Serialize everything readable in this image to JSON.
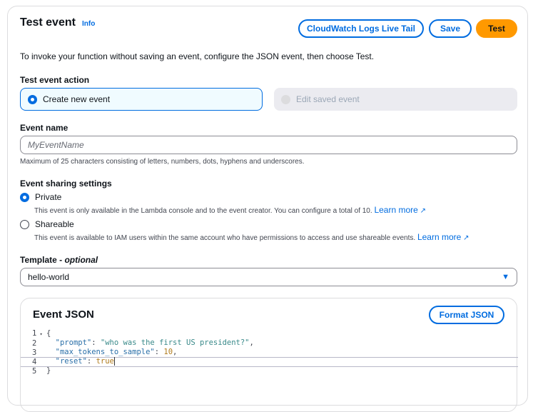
{
  "header": {
    "title": "Test event",
    "info": "Info",
    "live_tail": "CloudWatch Logs Live Tail",
    "save": "Save",
    "test": "Test"
  },
  "intro": "To invoke your function without saving an event, configure the JSON event, then choose Test.",
  "action": {
    "label": "Test event action",
    "create": "Create new event",
    "edit": "Edit saved event"
  },
  "event_name": {
    "label": "Event name",
    "placeholder": "MyEventName",
    "hint": "Maximum of 25 characters consisting of letters, numbers, dots, hyphens and underscores."
  },
  "sharing": {
    "label": "Event sharing settings",
    "private": "Private",
    "private_desc": "This event is only available in the Lambda console and to the event creator. You can configure a total of 10.",
    "shareable": "Shareable",
    "shareable_desc": "This event is available to IAM users within the same account who have permissions to access and use shareable events.",
    "learn_more": "Learn more"
  },
  "template": {
    "label": "Template",
    "optional": "optional",
    "value": "hello-world"
  },
  "json": {
    "title": "Event JSON",
    "format": "Format JSON",
    "lines": [
      "1",
      "2",
      "3",
      "4",
      "5"
    ],
    "code": {
      "open": "{",
      "k1": "\"prompt\"",
      "v1": "\"who was the first US president?\"",
      "k2": "\"max_tokens_to_sample\"",
      "v2": "10",
      "k3": "\"reset\"",
      "v3": "true",
      "close": "}"
    }
  }
}
